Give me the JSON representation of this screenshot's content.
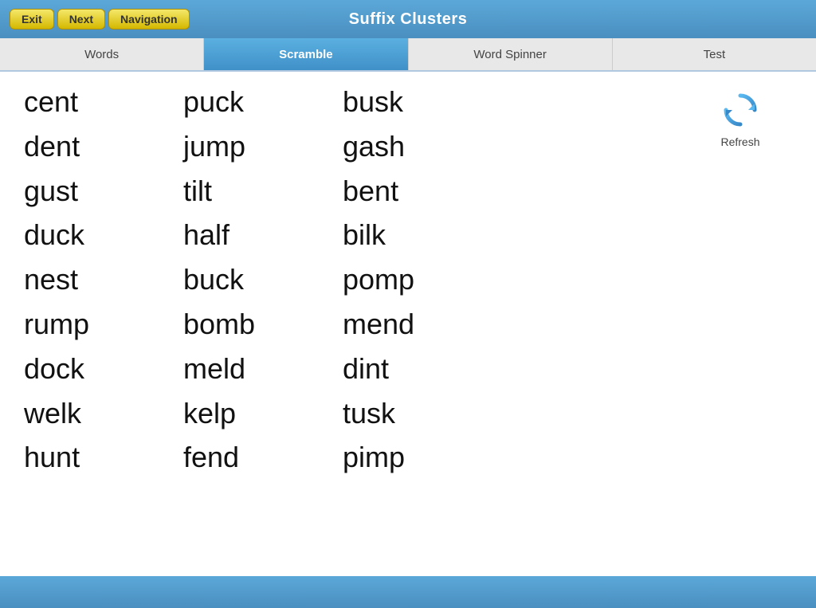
{
  "app": {
    "title": "Suffix Clusters"
  },
  "nav_buttons": [
    {
      "label": "Exit",
      "name": "exit-button"
    },
    {
      "label": "Next",
      "name": "next-button"
    },
    {
      "label": "Navigation",
      "name": "navigation-button"
    }
  ],
  "tabs": [
    {
      "label": "Words",
      "name": "tab-words",
      "active": false
    },
    {
      "label": "Scramble",
      "name": "tab-scramble",
      "active": true
    },
    {
      "label": "Word Spinner",
      "name": "tab-word-spinner",
      "active": false
    },
    {
      "label": "Test",
      "name": "tab-test",
      "active": false
    }
  ],
  "columns": {
    "col1": [
      "cent",
      "dent",
      "gust",
      "duck",
      "nest",
      "rump",
      "dock",
      "welk",
      "hunt"
    ],
    "col2": [
      "puck",
      "jump",
      "tilt",
      "half",
      "buck",
      "bomb",
      "meld",
      "kelp",
      "fend"
    ],
    "col3": [
      "busk",
      "gash",
      "bent",
      "bilk",
      "pomp",
      "mend",
      "dint",
      "tusk",
      "pimp"
    ]
  },
  "refresh": {
    "label": "Refresh"
  }
}
